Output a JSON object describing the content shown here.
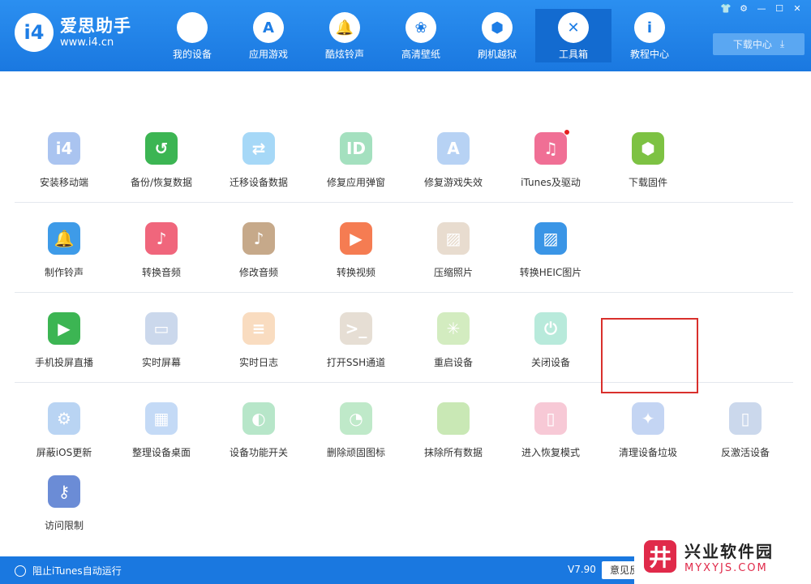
{
  "brand": {
    "name": "爱思助手",
    "url": "www.i4.cn",
    "logo_text": "i4"
  },
  "nav": [
    {
      "label": "我的设备",
      "icon": "apple-icon",
      "glyph": ""
    },
    {
      "label": "应用游戏",
      "icon": "app-store-icon",
      "glyph": "A"
    },
    {
      "label": "酷炫铃声",
      "icon": "bell-icon",
      "glyph": "🔔"
    },
    {
      "label": "高清壁纸",
      "icon": "flower-icon",
      "glyph": "❀"
    },
    {
      "label": "刷机越狱",
      "icon": "box-icon",
      "glyph": "⬢"
    },
    {
      "label": "工具箱",
      "icon": "tools-icon",
      "glyph": "✕"
    },
    {
      "label": "教程中心",
      "icon": "info-icon",
      "glyph": "i"
    }
  ],
  "window_controls": [
    {
      "name": "skin-icon",
      "glyph": "👕"
    },
    {
      "name": "settings-icon",
      "glyph": "⚙"
    },
    {
      "name": "minimize-icon",
      "glyph": "—"
    },
    {
      "name": "maximize-icon",
      "glyph": "☐"
    },
    {
      "name": "close-icon",
      "glyph": "✕"
    }
  ],
  "download_center": {
    "label": "下载中心",
    "icon": "download-icon",
    "glyph": "⤓"
  },
  "tools": [
    {
      "label": "安装移动端",
      "icon": "i4-mobile-icon",
      "color": "#aac4f0",
      "glyph": "i4"
    },
    {
      "label": "备份/恢复数据",
      "icon": "backup-clock-icon",
      "color": "#3cb553",
      "glyph": "↺"
    },
    {
      "label": "迁移设备数据",
      "icon": "transfer-icon",
      "color": "#a6d8f7",
      "glyph": "⇄"
    },
    {
      "label": "修复应用弹窗",
      "icon": "apple-id-icon",
      "color": "#a4e0bf",
      "glyph": "ID"
    },
    {
      "label": "修复游戏失效",
      "icon": "app-store-icon",
      "color": "#b7d2f4",
      "glyph": "A"
    },
    {
      "label": "iTunes及驱动",
      "icon": "itunes-icon",
      "color": "#f06f95",
      "glyph": "♫"
    },
    {
      "label": "下载固件",
      "icon": "cube-icon",
      "color": "#7dc243",
      "glyph": "⬢"
    },
    {
      "label": "制作铃声",
      "icon": "bell-plus-icon",
      "color": "#3e9be8",
      "glyph": "🔔"
    },
    {
      "label": "转换音频",
      "icon": "music-note-icon",
      "color": "#f0667c",
      "glyph": "♪"
    },
    {
      "label": "修改音频",
      "icon": "music-edit-icon",
      "color": "#c6a98a",
      "glyph": "♪"
    },
    {
      "label": "转换视频",
      "icon": "video-play-icon",
      "color": "#f57c52",
      "glyph": "▶"
    },
    {
      "label": "压缩照片",
      "icon": "photo-icon",
      "color": "#e8dccf",
      "glyph": "▨"
    },
    {
      "label": "转换HEIC图片",
      "icon": "heic-image-icon",
      "color": "#3a95e6",
      "glyph": "▨"
    },
    {
      "label": "手机投屏直播",
      "icon": "screen-cast-icon",
      "color": "#3cb553",
      "glyph": "▶"
    },
    {
      "label": "实时屏幕",
      "icon": "monitor-icon",
      "color": "#cbd8ec",
      "glyph": "▭"
    },
    {
      "label": "实时日志",
      "icon": "log-icon",
      "color": "#f9dcc0",
      "glyph": "≡"
    },
    {
      "label": "打开SSH通道",
      "icon": "terminal-icon",
      "color": "#e6ded4",
      "glyph": ">_"
    },
    {
      "label": "重启设备",
      "icon": "restart-icon",
      "color": "#d3ecc0",
      "glyph": "✳"
    },
    {
      "label": "关闭设备",
      "icon": "power-icon",
      "color": "#b8eadb",
      "glyph": "⏻"
    },
    {
      "label": "屏蔽iOS更新",
      "icon": "gear-block-icon",
      "color": "#b9d4f3",
      "glyph": "⚙"
    },
    {
      "label": "整理设备桌面",
      "icon": "grid-icon",
      "color": "#c4daf6",
      "glyph": "▦"
    },
    {
      "label": "设备功能开关",
      "icon": "toggle-switch-icon",
      "color": "#b7e6c9",
      "glyph": "◐"
    },
    {
      "label": "删除顽固图标",
      "icon": "pie-icon",
      "color": "#bfe9c9",
      "glyph": "◔"
    },
    {
      "label": "抹除所有数据",
      "icon": "apple-erase-icon",
      "color": "#c9e8b5",
      "glyph": ""
    },
    {
      "label": "进入恢复模式",
      "icon": "recovery-phone-icon",
      "color": "#f7c9d6",
      "glyph": "▯"
    },
    {
      "label": "清理设备垃圾",
      "icon": "broom-icon",
      "color": "#c4d5f3",
      "glyph": "✦"
    },
    {
      "label": "反激活设备",
      "icon": "deactivate-icon",
      "color": "#cbd8ec",
      "glyph": "▯"
    },
    {
      "label": "访问限制",
      "icon": "key-lock-icon",
      "color": "#6b8cd6",
      "glyph": "⚷"
    }
  ],
  "footer": {
    "toggle_label": "阻止iTunes自动运行",
    "version": "V7.90",
    "feedback_label": "意见反"
  },
  "watermark": {
    "name": "兴业软件园",
    "url": "MYXYJS.COM",
    "logo_glyph": "井"
  }
}
